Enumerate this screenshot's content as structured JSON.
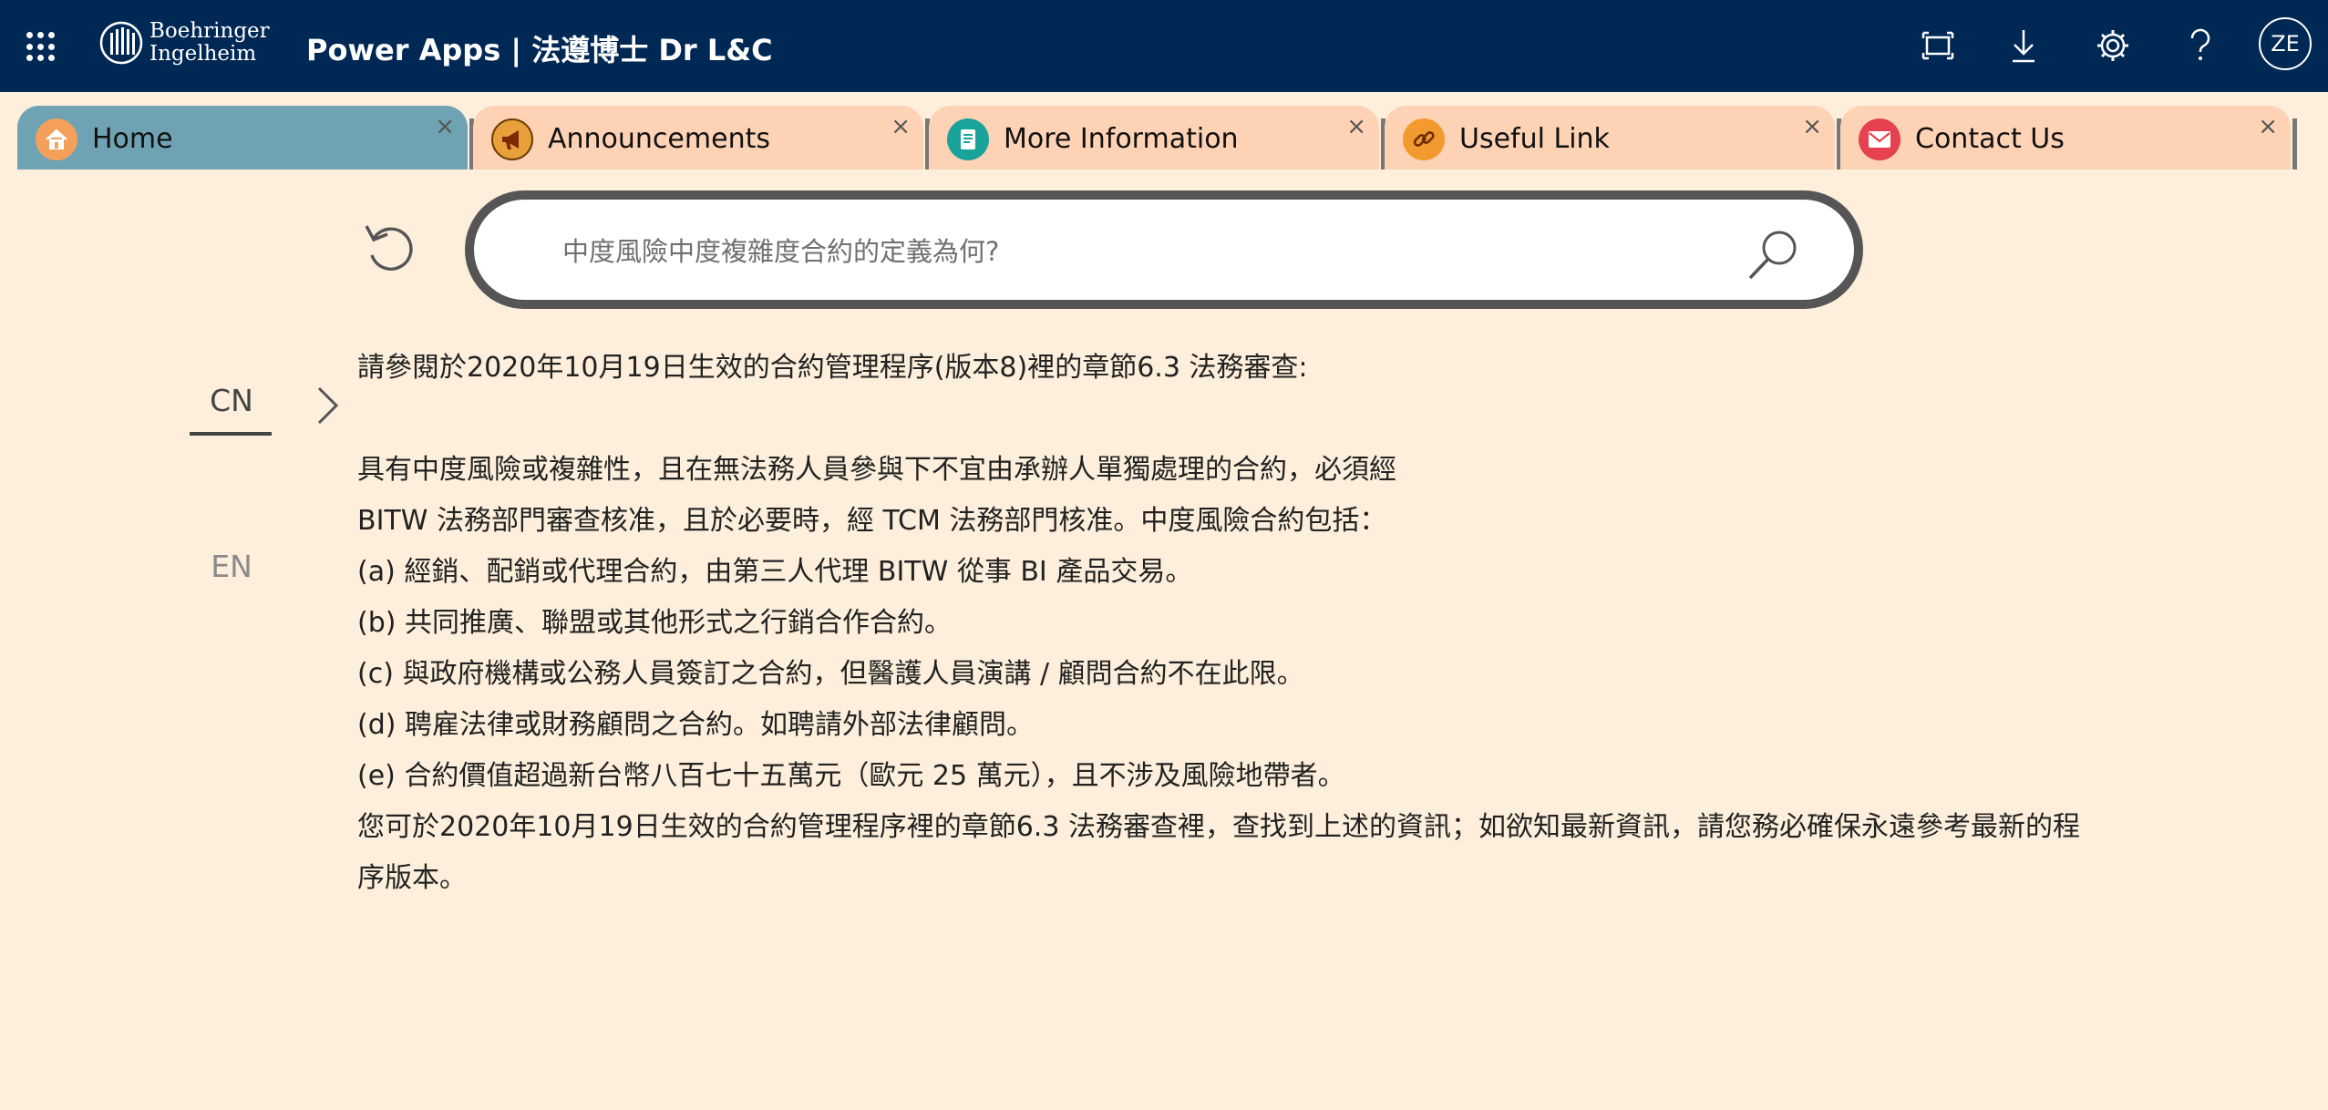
{
  "header": {
    "brand_line1": "Boehringer",
    "brand_line2": "Ingelheim",
    "app_title": "Power Apps  |  法遵博士 Dr L&C",
    "user_initials": "ZE"
  },
  "tabs": [
    {
      "label": "Home",
      "icon": "home-icon",
      "active": true
    },
    {
      "label": "Announcements",
      "icon": "megaphone-icon",
      "active": false
    },
    {
      "label": "More Information",
      "icon": "document-icon",
      "active": false
    },
    {
      "label": "Useful Link",
      "icon": "link-icon",
      "active": false
    },
    {
      "label": "Contact Us",
      "icon": "mail-icon",
      "active": false
    }
  ],
  "tab_close_glyph": "×",
  "search": {
    "placeholder": "中度風險中度複雜度合約的定義為何?"
  },
  "language": {
    "cn": "CN",
    "en": "EN",
    "selected": "CN"
  },
  "answer": {
    "lines": [
      "請參閱於2020年10月19日生效的合約管理程序(版本8)裡的章節6.3 法務審查:",
      "",
      " 具有中度風險或複雜性，且在無法務人員參與下不宜由承辦人單獨處理的合約，必須經",
      "BITW 法務部門審查核准，且於必要時，經 TCM 法務部門核准。中度風險合約包括：",
      "(a)  經銷、配銷或代理合約，由第三人代理 BITW 從事 BI 產品交易。",
      "(b) 共同推廣、聯盟或其他形式之行銷合作合約。",
      "(c) 與政府機構或公務人員簽訂之合約，但醫護人員演講 / 顧問合約不在此限。",
      "(d) 聘雇法律或財務顧問之合約。如聘請外部法律顧問。",
      "(e) 合約價值超過新台幣八百七十五萬元（歐元 25 萬元），且不涉及風險地帶者。",
      "您可於2020年10月19日生效的合約管理程序裡的章節6.3 法務審查裡，查找到上述的資訊；如欲知最新資訊，請您務必確保永遠參考最新的程",
      "序版本。"
    ]
  },
  "colors": {
    "topbar": "#002855",
    "background": "#fdefdb",
    "tab_active": "#6fa3b4",
    "tab_inactive": "#fdd2b5"
  }
}
